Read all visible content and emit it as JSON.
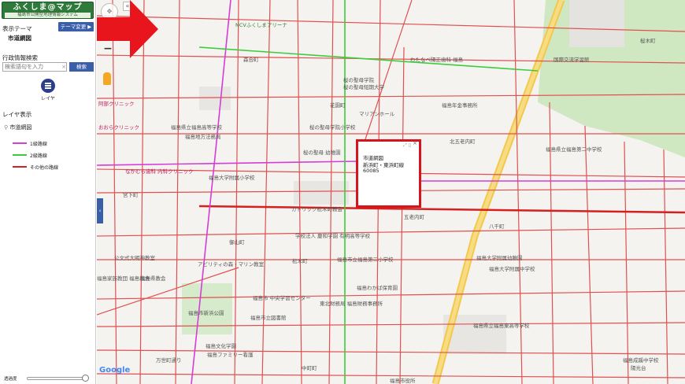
{
  "header": {
    "logo_title": "ふくしま@マップ",
    "logo_subtitle": "福島市公開型地理情報システム"
  },
  "theme": {
    "label": "表示テーマ",
    "change_button": "テーマ変更 ▶",
    "current": "市道網図"
  },
  "search": {
    "title": "行政情報検索",
    "placeholder": "検索語句を入力",
    "clear_label": "×",
    "button_label": "検索"
  },
  "layer_button": {
    "label": "レイヤ",
    "icon": "list-icon"
  },
  "layers": {
    "title": "レイヤ表示",
    "group": "市道網図",
    "legend": [
      {
        "label": "1級路線",
        "color": "#d63cd6"
      },
      {
        "label": "2級路線",
        "color": "#3ccc3c"
      },
      {
        "label": "その他の路線",
        "color": "#d62020"
      }
    ]
  },
  "opacity": {
    "label": "透過度",
    "value_fraction": 0.95
  },
  "map": {
    "zoom_in": "+",
    "zoom_out": "−",
    "collapse": "«",
    "side_tab": "‹",
    "google": "Google",
    "labels": [
      "NCVふくしまアリーナ",
      "森合町",
      "桜の聖母学院",
      "桜の聖母短期大学",
      "花園町",
      "マリアンホール",
      "桜の聖母学院小学校",
      "桜の聖母 幼稚園",
      "福島大学附属小学校",
      "カトリック松木町教会",
      "五老内町",
      "御山町",
      "松木町",
      "福島市立福島第二小学校",
      "福島わかば保育園",
      "福島市 中央学習センター",
      "東北財務局 福島財務事務所",
      "福島市立図書館",
      "福島市新浜公園",
      "アビリティの森・マリン教室",
      "福島文化学園",
      "中町町",
      "万世町通り",
      "公文式大明神教室",
      "福島大学附属幼稚園",
      "福島大学附属中学校",
      "福島県立福島東高等学校",
      "八千町",
      "北五老内町",
      "福島県立福島第二中学校",
      "福島県立福島高等学校",
      "福島地方法務局",
      "わたなべ陽正歯科 福島",
      "福島年金事務所",
      "なかむら歯科 内科クリニック",
      "国際交流学習館",
      "桜木町",
      "阿部クリニック",
      "福島成蹊中学校",
      "陽光台",
      "宮下町",
      "おおらクリニック",
      "学校法人 慶和学園 有明高等学校",
      "福島県教会",
      "福島市役所",
      "福島ファミリー看護",
      "福島家族教団 福島教会"
    ]
  },
  "popup": {
    "layer": "市道網図",
    "name": "新浜町・東浜町線",
    "id": "60085",
    "tools": "⤢ ▯",
    "close": "×"
  }
}
